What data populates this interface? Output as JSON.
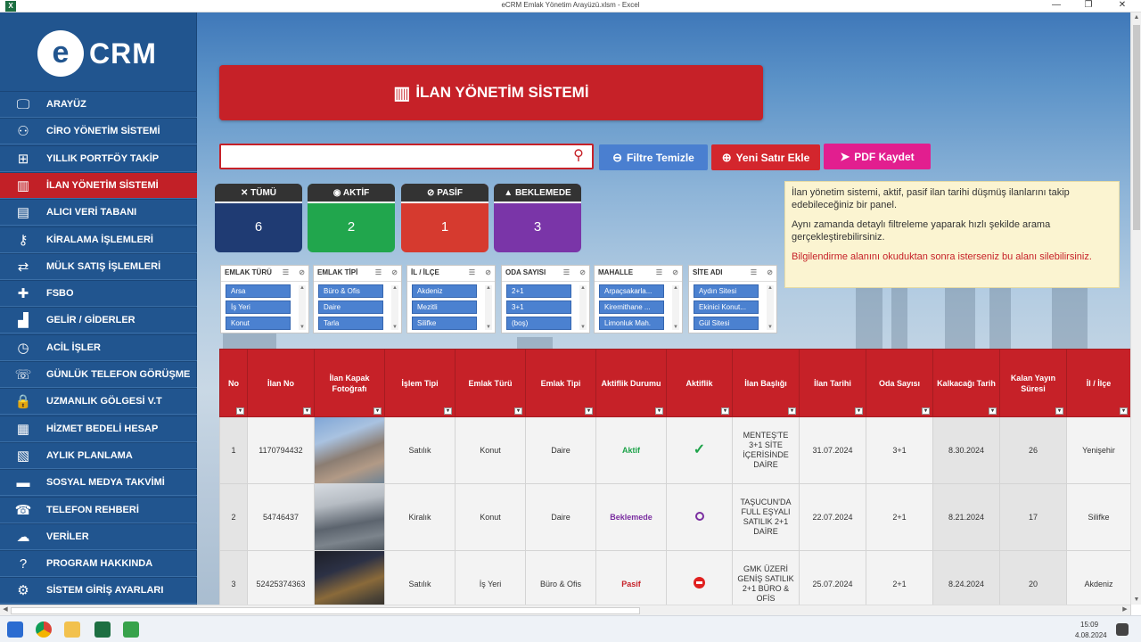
{
  "window": {
    "title": "eCRM Emlak Yönetim Arayüzü.xlsm - Excel",
    "app_icon": "X",
    "min": "—",
    "restore": "❐",
    "close": "✕"
  },
  "logo": {
    "mark": "e",
    "text": "CRM"
  },
  "nav": [
    {
      "label": "ARAYÜZ",
      "icon": "🖵"
    },
    {
      "label": "CİRO YÖNETİM SİSTEMİ",
      "icon": "⚇"
    },
    {
      "label": "YILLIK PORTFÖY TAKİP",
      "icon": "⊞"
    },
    {
      "label": "İLAN YÖNETİM SİSTEMİ",
      "icon": "▥"
    },
    {
      "label": "ALICI VERİ TABANI",
      "icon": "▤"
    },
    {
      "label": "KİRALAMA İŞLEMLERİ",
      "icon": "⚷"
    },
    {
      "label": "MÜLK SATIŞ İŞLEMLERİ",
      "icon": "⇄"
    },
    {
      "label": "FSBO",
      "icon": "✚"
    },
    {
      "label": "GELİR / GİDERLER",
      "icon": "▟"
    },
    {
      "label": "ACİL İŞLER",
      "icon": "◷"
    },
    {
      "label": "GÜNLÜK TELEFON GÖRÜŞME",
      "icon": "☏"
    },
    {
      "label": "UZMANLIK GÖLGESİ V.T",
      "icon": "🔒"
    },
    {
      "label": "HİZMET BEDELİ HESAP",
      "icon": "▦"
    },
    {
      "label": "AYLIK PLANLAMA",
      "icon": "▧"
    },
    {
      "label": "SOSYAL MEDYA TAKVİMİ",
      "icon": "▬"
    },
    {
      "label": "TELEFON REHBERİ",
      "icon": "☎"
    },
    {
      "label": "VERİLER",
      "icon": "☁"
    },
    {
      "label": "PROGRAM HAKKINDA",
      "icon": "?"
    },
    {
      "label": "SİSTEM GİRİŞ AYARLARI",
      "icon": "⚙"
    }
  ],
  "banner": {
    "title": "İLAN YÖNETİM SİSTEMİ",
    "icon": "▥"
  },
  "search": {
    "value": "",
    "icon": "⚲"
  },
  "buttons": {
    "clear": {
      "label": "Filtre Temizle",
      "icon": "⊖",
      "color": "#4a7fd0"
    },
    "add": {
      "label": "Yeni Satır Ekle",
      "icon": "⊕",
      "color": "#d3262d"
    },
    "pdf": {
      "label": "PDF Kaydet",
      "icon": "➤",
      "color": "#e21e8f"
    }
  },
  "cards": [
    {
      "label": "TÜMÜ",
      "icon": "✕",
      "value": "6",
      "color": "#1f3b73"
    },
    {
      "label": "AKTİF",
      "icon": "◉",
      "value": "2",
      "color": "#21a64d"
    },
    {
      "label": "PASİF",
      "icon": "⊘",
      "value": "1",
      "color": "#d63a2f"
    },
    {
      "label": "BEKLEMEDE",
      "icon": "▲",
      "value": "3",
      "color": "#7a35a8"
    }
  ],
  "info": {
    "p1": "İlan yönetim sistemi, aktif, pasif ilan tarihi düşmüş ilanlarını takip edebileceğiniz bir panel.",
    "p2": "Aynı zamanda detaylı filtreleme yaparak hızlı şekilde arama gerçekleştirebilirsiniz.",
    "p3": "Bilgilendirme alanını okuduktan sonra isterseniz bu alanı silebilirsiniz."
  },
  "slicers": [
    {
      "title": "EMLAK TÜRÜ",
      "items": [
        "Arsa",
        "İş Yeri",
        "Konut"
      ]
    },
    {
      "title": "EMLAK TİPİ",
      "items": [
        "Büro & Ofis",
        "Daire",
        "Tarla"
      ]
    },
    {
      "title": "İL / İLÇE",
      "items": [
        "Akdeniz",
        "Mezitli",
        "Silifke"
      ]
    },
    {
      "title": "ODA SAYISI",
      "items": [
        "2+1",
        "3+1",
        "(boş)"
      ]
    },
    {
      "title": "MAHALLE",
      "items": [
        "Arpaçsakarla...",
        "Kiremithane ...",
        "Limonluk Mah."
      ]
    },
    {
      "title": "SİTE ADI",
      "items": [
        "Aydın Sitesi",
        "Ekinici Konut...",
        "Gül Sitesi"
      ]
    }
  ],
  "table": {
    "headers": [
      "No",
      "İlan No",
      "İlan Kapak Fotoğrafı",
      "İşlem Tipi",
      "Emlak Türü",
      "Emlak Tipi",
      "Aktiflik Durumu",
      "Aktiflik",
      "İlan Başlığı",
      "İlan Tarihi",
      "Oda Sayısı",
      "Kalkacağı Tarih",
      "Kalan Yayın Süresi",
      "İl / İlçe"
    ],
    "rows": [
      {
        "no": "1",
        "ilan_no": "1170794432",
        "islem": "Satılık",
        "tur": "Konut",
        "tip": "Daire",
        "durum": "Aktif",
        "durum_cls": "st-a",
        "aktiflik": "ok",
        "baslik": "MENTEŞ'TE 3+1 SİTE İÇERİSİNDE DAİRE",
        "tarih": "31.07.2024",
        "oda": "3+1",
        "kalkacak": "8.30.2024",
        "kalan": "26",
        "il": "Yenişehir"
      },
      {
        "no": "2",
        "ilan_no": "54746437",
        "islem": "Kiralık",
        "tur": "Konut",
        "tip": "Daire",
        "durum": "Beklemede",
        "durum_cls": "st-b",
        "aktiflik": "wait",
        "baslik": "TAŞUCUN'DA FULL EŞYALI SATILIK 2+1 DAİRE",
        "tarih": "22.07.2024",
        "oda": "2+1",
        "kalkacak": "8.21.2024",
        "kalan": "17",
        "il": "Silifke"
      },
      {
        "no": "3",
        "ilan_no": "52425374363",
        "islem": "Satılık",
        "tur": "İş Yeri",
        "tip": "Büro & Ofis",
        "durum": "Pasif",
        "durum_cls": "st-p",
        "aktiflik": "no",
        "baslik": "GMK ÜZERİ GENİŞ SATILIK 2+1 BÜRO & OFİS",
        "tarih": "25.07.2024",
        "oda": "2+1",
        "kalkacak": "8.24.2024",
        "kalan": "20",
        "il": "Akdeniz"
      }
    ]
  },
  "taskbar": {
    "time": "15:09",
    "date": "4.08.2024"
  }
}
